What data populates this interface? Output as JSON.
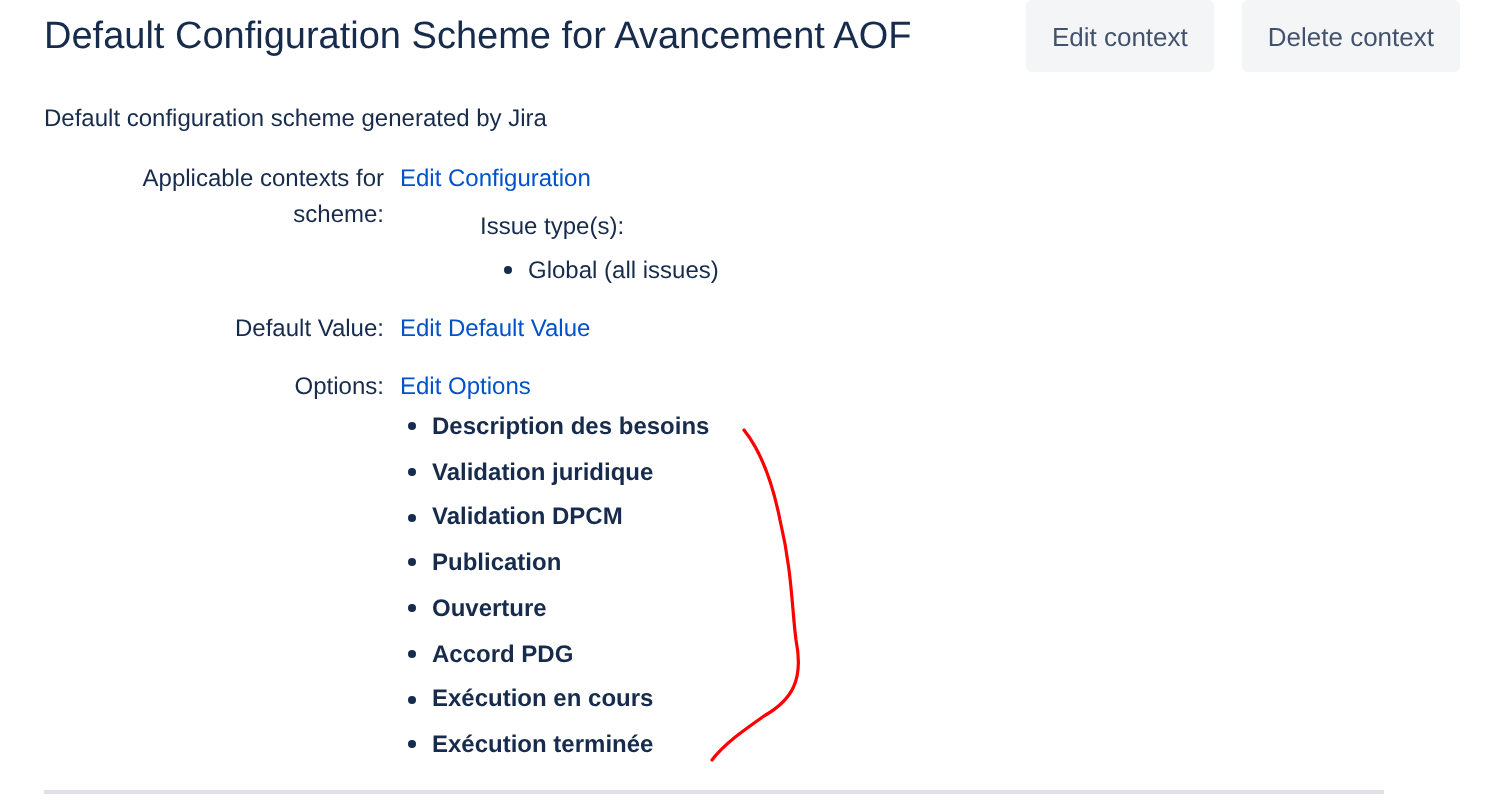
{
  "title": "Default Configuration Scheme for Avancement AOF",
  "buttons": [
    "Edit context",
    "Delete context"
  ],
  "description": "Default configuration scheme generated by Jira",
  "fields": [
    {
      "label": "Applicable contexts for scheme:",
      "link": "Edit Configuration",
      "sublabel": "Issue type(s):",
      "items": [
        "Global (all issues)"
      ]
    },
    {
      "label": "Default Value:",
      "link": "Edit Default Value"
    },
    {
      "label": "Options:",
      "link": "Edit Options",
      "options": [
        "Description des besoins",
        "Validation juridique",
        "Validation DPCM",
        "Publication",
        "Ouverture",
        "Accord PDG",
        "Exécution en cours",
        "Exécution terminée"
      ]
    }
  ],
  "annotation": {
    "kind": "curve"
  }
}
